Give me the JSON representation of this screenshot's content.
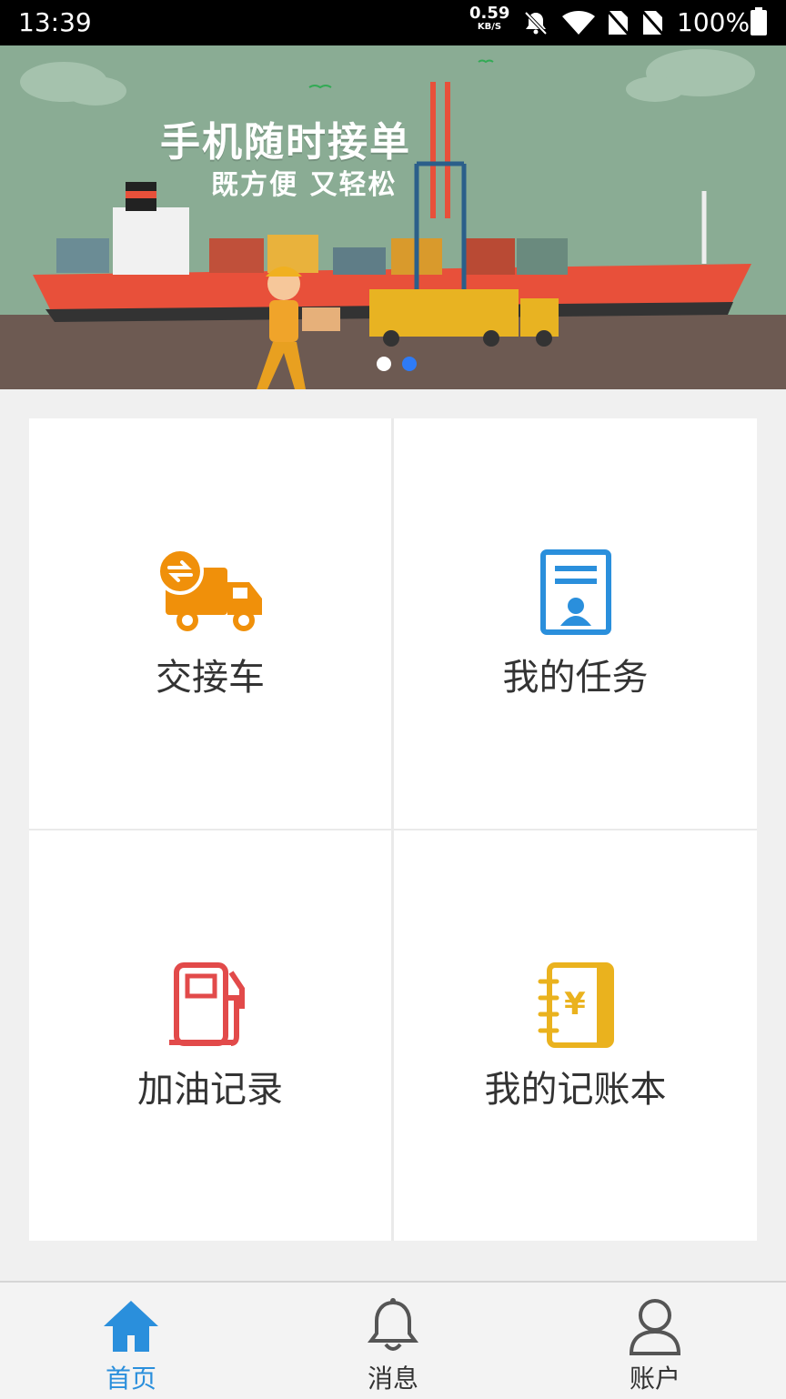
{
  "status_bar": {
    "time": "13:39",
    "net_speed_value": "0.59",
    "net_speed_unit": "KB/S",
    "battery": "100%",
    "icons": [
      "bell-off-icon",
      "wifi-icon",
      "no-sim-icon",
      "no-sim-icon",
      "battery-icon"
    ]
  },
  "banner": {
    "title": "手机随时接单",
    "subtitle": "既方便 又轻松",
    "active_slide": 2,
    "slide_count": 2
  },
  "menu": {
    "items": [
      {
        "label": "交接车",
        "icon": "truck-swap-icon",
        "color": "#f0900a"
      },
      {
        "label": "我的任务",
        "icon": "task-profile-icon",
        "color": "#2a8fdc"
      },
      {
        "label": "加油记录",
        "icon": "fuel-pump-icon",
        "color": "#e24a4a"
      },
      {
        "label": "我的记账本",
        "icon": "ledger-book-icon",
        "color": "#eab21e"
      }
    ]
  },
  "bottom_nav": {
    "items": [
      {
        "label": "首页",
        "icon": "home-icon",
        "active": true
      },
      {
        "label": "消息",
        "icon": "bell-icon",
        "active": false
      },
      {
        "label": "账户",
        "icon": "user-icon",
        "active": false
      }
    ],
    "active_color": "#2a8fdc",
    "inactive_color": "#333333"
  }
}
